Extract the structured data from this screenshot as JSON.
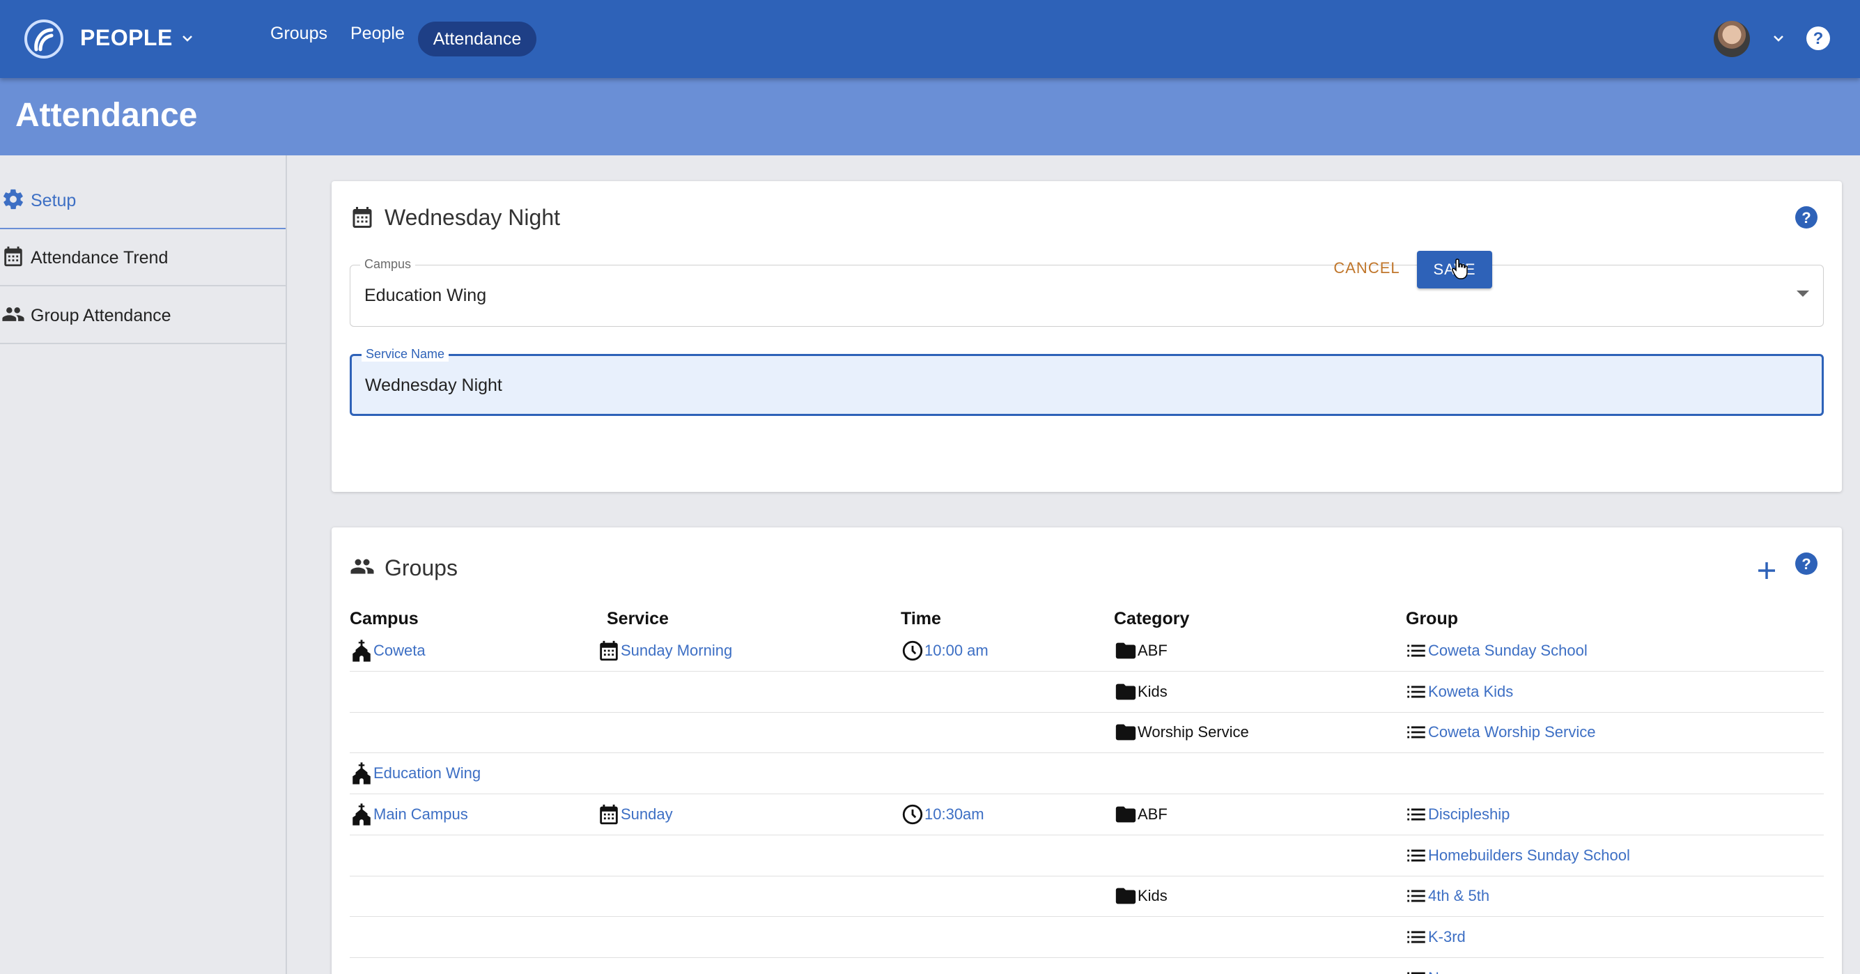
{
  "app": {
    "name": "PEOPLE",
    "nav": [
      "Groups",
      "People",
      "Attendance"
    ],
    "active_nav": "Attendance"
  },
  "page": {
    "title": "Attendance"
  },
  "sidebar": {
    "items": [
      {
        "label": "Setup",
        "icon": "gear-icon",
        "active": true
      },
      {
        "label": "Attendance Trend",
        "icon": "calendar-icon",
        "active": false
      },
      {
        "label": "Group Attendance",
        "icon": "people-icon",
        "active": false
      }
    ]
  },
  "service_card": {
    "title": "Wednesday Night",
    "campus": {
      "label": "Campus",
      "value": "Education Wing"
    },
    "service_name": {
      "label": "Service Name",
      "value": "Wednesday Night"
    },
    "cancel_label": "CANCEL",
    "save_label": "SAVE"
  },
  "groups_card": {
    "title": "Groups",
    "headers": [
      "Campus",
      "Service",
      "Time",
      "Category",
      "Group"
    ],
    "rows": [
      {
        "campus": "Coweta",
        "service": "Sunday Morning",
        "time": "10:00 am",
        "category": "ABF",
        "group": "Coweta Sunday School"
      },
      {
        "campus": "",
        "service": "",
        "time": "",
        "category": "Kids",
        "group": "Koweta Kids"
      },
      {
        "campus": "",
        "service": "",
        "time": "",
        "category": "Worship Service",
        "group": "Coweta Worship Service"
      },
      {
        "campus": "Education Wing",
        "service": "",
        "time": "",
        "category": "",
        "group": ""
      },
      {
        "campus": "Main Campus",
        "service": "Sunday",
        "time": "10:30am",
        "category": "ABF",
        "group": "Discipleship"
      },
      {
        "campus": "",
        "service": "",
        "time": "",
        "category": "",
        "group": "Homebuilders Sunday School"
      },
      {
        "campus": "",
        "service": "",
        "time": "",
        "category": "Kids",
        "group": "4th & 5th"
      },
      {
        "campus": "",
        "service": "",
        "time": "",
        "category": "",
        "group": "K-3rd"
      },
      {
        "campus": "",
        "service": "",
        "time": "",
        "category": "",
        "group": "N..."
      }
    ]
  },
  "colors": {
    "nav_bar": "#2e62b8",
    "header_band": "#6a8fd6",
    "link": "#3d6fc4",
    "cancel": "#c0762b",
    "nav_pill": "#1e3f86"
  }
}
